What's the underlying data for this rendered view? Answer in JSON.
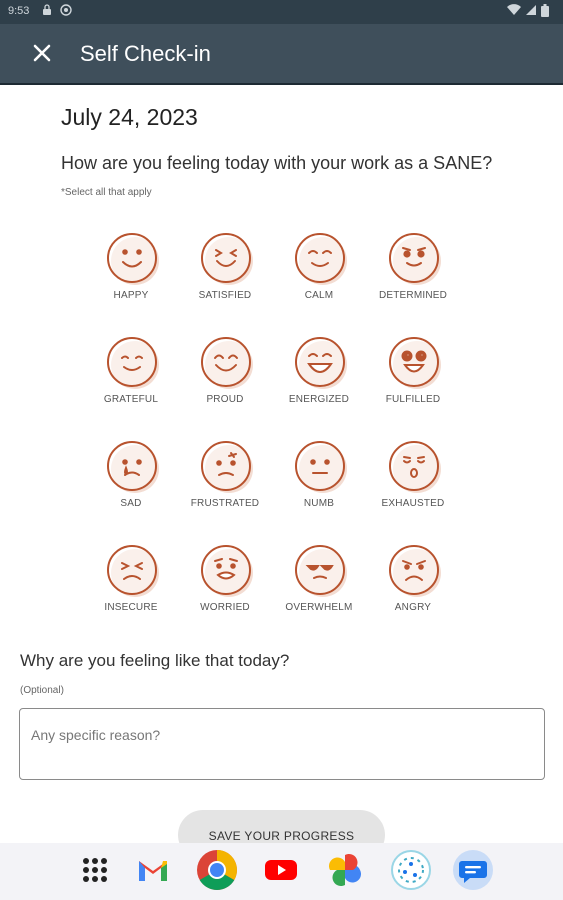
{
  "status_bar": {
    "time": "9:53"
  },
  "app_bar": {
    "title": "Self Check-in"
  },
  "content": {
    "date": "July 24, 2023",
    "question": "How are you feeling today with your work as a SANE?",
    "select_note": "*Select all that apply",
    "emotions": [
      {
        "label": "HAPPY",
        "icon": "happy-face-icon"
      },
      {
        "label": "SATISFIED",
        "icon": "satisfied-face-icon"
      },
      {
        "label": "CALM",
        "icon": "calm-face-icon"
      },
      {
        "label": "DETERMINED",
        "icon": "determined-face-icon"
      },
      {
        "label": "GRATEFUL",
        "icon": "grateful-face-icon"
      },
      {
        "label": "PROUD",
        "icon": "proud-face-icon"
      },
      {
        "label": "ENERGIZED",
        "icon": "energized-face-icon"
      },
      {
        "label": "FULFILLED",
        "icon": "fulfilled-face-icon"
      },
      {
        "label": "SAD",
        "icon": "sad-face-icon"
      },
      {
        "label": "FRUSTRATED",
        "icon": "frustrated-face-icon"
      },
      {
        "label": "NUMB",
        "icon": "numb-face-icon"
      },
      {
        "label": "EXHAUSTED",
        "icon": "exhausted-face-icon"
      },
      {
        "label": "INSECURE",
        "icon": "insecure-face-icon"
      },
      {
        "label": "WORRIED",
        "icon": "worried-face-icon"
      },
      {
        "label": "OVERWHELM",
        "icon": "overwhelm-face-icon"
      },
      {
        "label": "ANGRY",
        "icon": "angry-face-icon"
      }
    ],
    "why_title": "Why are you feeling like that today?",
    "optional_note": "(Optional)",
    "reason_placeholder": "Any specific reason?",
    "reason_value": "",
    "save_label": "SAVE YOUR PROGRESS"
  },
  "dock": {
    "apps": [
      "app-drawer-icon",
      "gmail-icon",
      "chrome-icon",
      "youtube-icon",
      "photos-icon",
      "assistant-icon",
      "messages-icon"
    ]
  },
  "colors": {
    "app_bar": "#3f4f5b",
    "status_bar": "#2f3f4a",
    "face_stroke": "#b8532e",
    "face_fill": "#f3ddd3"
  }
}
